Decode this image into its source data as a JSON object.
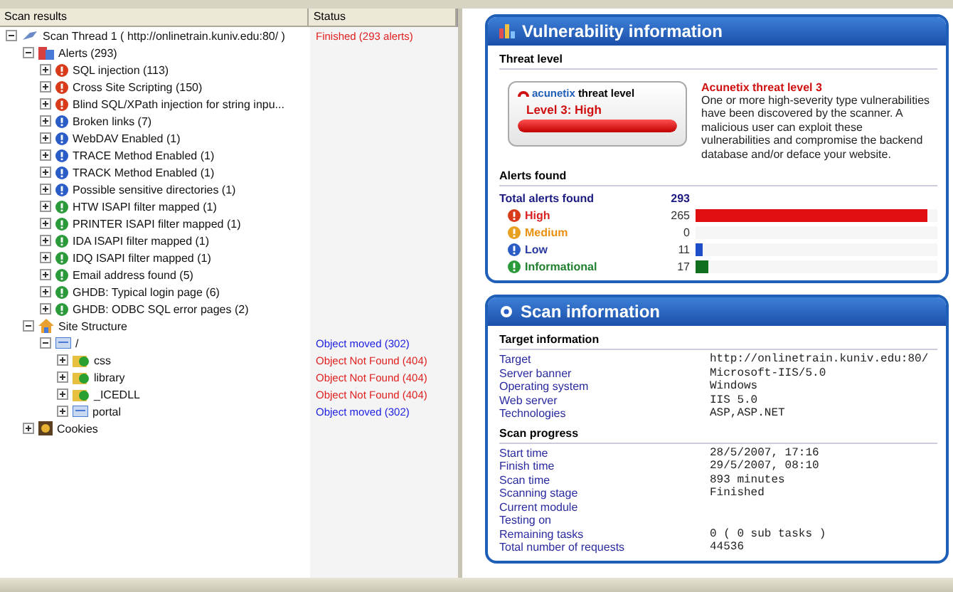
{
  "tree_header": {
    "columns": [
      "Scan results",
      "Status"
    ]
  },
  "tree": [
    {
      "kind": "thread",
      "label": "Scan Thread 1 ( http://onlinetrain.kuniv.edu:80/ )",
      "status": "Finished (293 alerts)",
      "color": "#e02020",
      "expanded": true,
      "children": [
        {
          "kind": "alerts",
          "label": "Alerts (293)",
          "expanded": true,
          "children": [
            {
              "kind": "high",
              "label": "SQL injection (113)",
              "expanded": false
            },
            {
              "kind": "high",
              "label": "Cross Site Scripting (150)",
              "expanded": false
            },
            {
              "kind": "high",
              "label": "Blind SQL/XPath injection for string inpu...",
              "expanded": false
            },
            {
              "kind": "low",
              "label": "Broken links (7)",
              "expanded": false
            },
            {
              "kind": "low",
              "label": "WebDAV Enabled (1)",
              "expanded": false
            },
            {
              "kind": "low",
              "label": "TRACE Method Enabled (1)",
              "expanded": false
            },
            {
              "kind": "low",
              "label": "TRACK Method Enabled (1)",
              "expanded": false
            },
            {
              "kind": "low",
              "label": "Possible sensitive directories (1)",
              "expanded": false
            },
            {
              "kind": "info",
              "label": "HTW ISAPI filter mapped (1)",
              "expanded": false
            },
            {
              "kind": "info",
              "label": "PRINTER ISAPI filter mapped (1)",
              "expanded": false
            },
            {
              "kind": "info",
              "label": "IDA ISAPI filter mapped (1)",
              "expanded": false
            },
            {
              "kind": "info",
              "label": "IDQ ISAPI filter mapped (1)",
              "expanded": false
            },
            {
              "kind": "info",
              "label": "Email address found (5)",
              "expanded": false
            },
            {
              "kind": "info",
              "label": "GHDB: Typical login page (6)",
              "expanded": false
            },
            {
              "kind": "info",
              "label": "GHDB: ODBC SQL error pages (2)",
              "expanded": false
            }
          ]
        },
        {
          "kind": "site",
          "label": "Site Structure",
          "expanded": true,
          "children": [
            {
              "kind": "dir",
              "label": "/",
              "status": "Object moved (302)",
              "color": "#2020e0",
              "expanded": true,
              "children": [
                {
                  "kind": "folder",
                  "label": "css",
                  "status": "Object Not Found (404)",
                  "color": "#e02020",
                  "expanded": false
                },
                {
                  "kind": "folder",
                  "label": "library",
                  "status": "Object Not Found (404)",
                  "color": "#e02020",
                  "expanded": false
                },
                {
                  "kind": "folder",
                  "label": "_ICEDLL",
                  "status": "Object Not Found (404)",
                  "color": "#e02020",
                  "expanded": false
                },
                {
                  "kind": "dir",
                  "label": "portal",
                  "status": "Object moved (302)",
                  "color": "#2020e0",
                  "expanded": false
                }
              ]
            }
          ]
        },
        {
          "kind": "cookies",
          "label": "Cookies",
          "expanded": false
        }
      ]
    }
  ],
  "vulnerability": {
    "title": "Vulnerability information",
    "threat_section": "Threat level",
    "badge": {
      "brand": "acunetix",
      "caption": "threat level",
      "level_text": "Level 3: High",
      "level": 1
    },
    "threat_title": "Acunetix threat level 3",
    "threat_text": "One or more high-severity type vulnerabilities have been discovered by the scanner. A malicious user can exploit these vulnerabilities and compromise the backend database and/or deface your website.",
    "alerts_section": "Alerts found",
    "total_label": "Total alerts found",
    "total": "293",
    "severities": [
      {
        "kind": "high",
        "label": "High",
        "count": "265",
        "level": 0.96
      },
      {
        "kind": "medium",
        "label": "Medium",
        "count": "0"
      },
      {
        "kind": "low",
        "label": "Low",
        "count": "11",
        "level": 0.03
      },
      {
        "kind": "info",
        "label": "Informational",
        "count": "17",
        "level": 0.05
      }
    ]
  },
  "scan": {
    "title": "Scan information",
    "sections": [
      {
        "title": "Target information",
        "rows": [
          {
            "label": "Target",
            "value": "http://onlinetrain.kuniv.edu:80/"
          },
          {
            "label": "Server banner",
            "value": "Microsoft-IIS/5.0"
          },
          {
            "label": "Operating system",
            "value": "Windows"
          },
          {
            "label": "Web server",
            "value": "IIS 5.0"
          },
          {
            "label": "Technologies",
            "value": "ASP,ASP.NET"
          }
        ]
      },
      {
        "title": "Scan progress",
        "rows": [
          {
            "label": "Start time",
            "value": "28/5/2007, 17:16"
          },
          {
            "label": "Finish time",
            "value": "29/5/2007, 08:10"
          },
          {
            "label": "Scan time",
            "value": "893 minutes"
          },
          {
            "label": "Scanning stage",
            "value": "Finished"
          },
          {
            "label": "Current module"
          },
          {
            "label": "Testing on"
          },
          {
            "label": "Remaining tasks",
            "value": "0 ( 0 sub tasks )"
          },
          {
            "label": "Total number of requests",
            "value": "44536"
          }
        ]
      }
    ]
  }
}
